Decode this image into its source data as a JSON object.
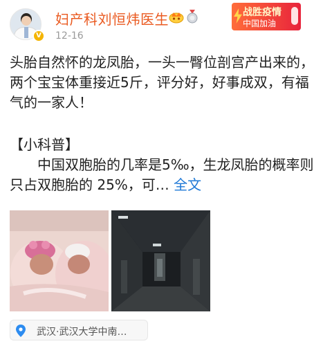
{
  "header": {
    "username": "妇产科刘恒炜医生",
    "date": "12-16",
    "verified": true,
    "avatar_icon": "doctor-avatar",
    "badges": [
      "crown-icon",
      "medal-icon"
    ]
  },
  "campaign": {
    "line1": "战胜疫情",
    "line2": "中国加油"
  },
  "post": {
    "paragraph1": "头胎自然怀的龙凤胎，一头一臀位剖宫产出来的，两个宝宝体重接近5斤，评分好，好事成双，有福气的一家人！",
    "section_title": "【小科普】",
    "paragraph2": "中国双胞胎的几率是5‰，生龙凤胎的概率则只占双胞胎的 25%，可…",
    "full_text_link": "全文"
  },
  "images": [
    {
      "name": "newborn-twins-photo"
    },
    {
      "name": "hospital-corridor-photo"
    }
  ],
  "location": {
    "label": "武汉·武汉大学中南…",
    "icon": "location-pin-icon"
  },
  "colors": {
    "username": "#ea5a20",
    "link": "#1e78d6",
    "date": "#9a9a9a",
    "text": "#222222",
    "pin": "#2d8cf0"
  }
}
